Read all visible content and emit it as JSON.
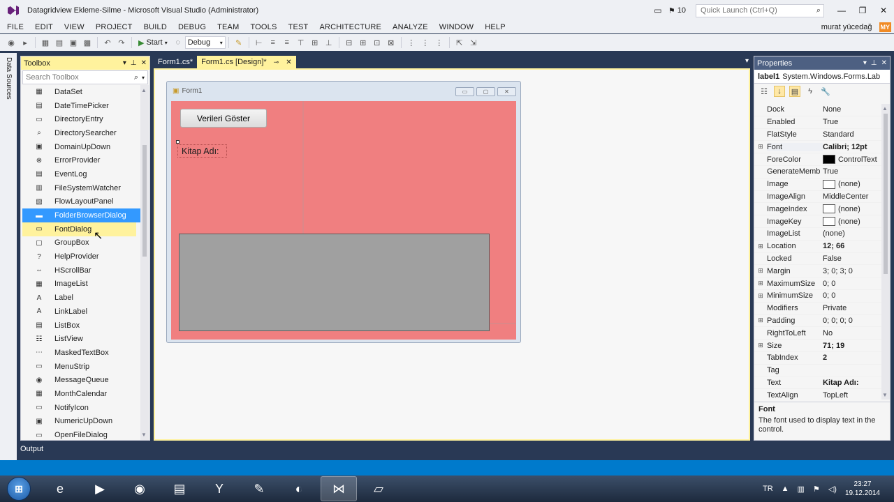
{
  "window": {
    "title": "Datagridview Ekleme-Silme - Microsoft Visual Studio (Administrator)",
    "notifications_count": "10",
    "quick_launch_placeholder": "Quick Launch (Ctrl+Q)"
  },
  "menu": {
    "items": [
      "FILE",
      "EDIT",
      "VIEW",
      "PROJECT",
      "BUILD",
      "DEBUG",
      "TEAM",
      "TOOLS",
      "TEST",
      "ARCHITECTURE",
      "ANALYZE",
      "WINDOW",
      "HELP"
    ],
    "user_name": "murat yücedağ",
    "user_initials": "MY"
  },
  "toolbar": {
    "start_label": "Start",
    "configuration": "Debug"
  },
  "side_strip": {
    "label": "Data Sources"
  },
  "toolbox": {
    "title": "Toolbox",
    "search_placeholder": "Search Toolbox",
    "items": [
      {
        "label": "DataSet",
        "icon": "dataset-icon",
        "glyph": "▦"
      },
      {
        "label": "DateTimePicker",
        "icon": "datetimepicker-icon",
        "glyph": "▤"
      },
      {
        "label": "DirectoryEntry",
        "icon": "directoryentry-icon",
        "glyph": "▭"
      },
      {
        "label": "DirectorySearcher",
        "icon": "directorysearcher-icon",
        "glyph": "⌕"
      },
      {
        "label": "DomainUpDown",
        "icon": "domainupdown-icon",
        "glyph": "▣"
      },
      {
        "label": "ErrorProvider",
        "icon": "errorprovider-icon",
        "glyph": "⊗"
      },
      {
        "label": "EventLog",
        "icon": "eventlog-icon",
        "glyph": "▤"
      },
      {
        "label": "FileSystemWatcher",
        "icon": "filesystemwatcher-icon",
        "glyph": "▥"
      },
      {
        "label": "FlowLayoutPanel",
        "icon": "flowlayoutpanel-icon",
        "glyph": "▧"
      },
      {
        "label": "FolderBrowserDialog",
        "icon": "folderbrowserdialog-icon",
        "glyph": "▬"
      },
      {
        "label": "FontDialog",
        "icon": "fontdialog-icon",
        "glyph": "▭"
      },
      {
        "label": "GroupBox",
        "icon": "groupbox-icon",
        "glyph": "▢"
      },
      {
        "label": "HelpProvider",
        "icon": "helpprovider-icon",
        "glyph": "?"
      },
      {
        "label": "HScrollBar",
        "icon": "hscrollbar-icon",
        "glyph": "⇔"
      },
      {
        "label": "ImageList",
        "icon": "imagelist-icon",
        "glyph": "▦"
      },
      {
        "label": "Label",
        "icon": "label-icon",
        "glyph": "A"
      },
      {
        "label": "LinkLabel",
        "icon": "linklabel-icon",
        "glyph": "A"
      },
      {
        "label": "ListBox",
        "icon": "listbox-icon",
        "glyph": "▤"
      },
      {
        "label": "ListView",
        "icon": "listview-icon",
        "glyph": "☷"
      },
      {
        "label": "MaskedTextBox",
        "icon": "maskedtextbox-icon",
        "glyph": "⋯"
      },
      {
        "label": "MenuStrip",
        "icon": "menustrip-icon",
        "glyph": "▭"
      },
      {
        "label": "MessageQueue",
        "icon": "messagequeue-icon",
        "glyph": "◉"
      },
      {
        "label": "MonthCalendar",
        "icon": "monthcalendar-icon",
        "glyph": "▦"
      },
      {
        "label": "NotifyIcon",
        "icon": "notifyicon-icon",
        "glyph": "▭"
      },
      {
        "label": "NumericUpDown",
        "icon": "numericupdown-icon",
        "glyph": "▣"
      },
      {
        "label": "OpenFileDialog",
        "icon": "openfiledialog-icon",
        "glyph": "▭"
      }
    ],
    "selected_index": 9,
    "hover_index": 10
  },
  "tabs": [
    {
      "label": "Form1.cs*",
      "active": false
    },
    {
      "label": "Form1.cs [Design]*",
      "active": true
    }
  ],
  "designer": {
    "form_title": "Form1",
    "form_backcolor": "#f07f80",
    "button_text": "Verileri Göster",
    "label_text": "Kitap Adı:"
  },
  "properties": {
    "title": "Properties",
    "object_name": "label1",
    "object_type": "System.Windows.Forms.Lab",
    "rows": [
      {
        "name": "Dock",
        "value": "None",
        "expandable": false,
        "bold": false
      },
      {
        "name": "Enabled",
        "value": "True",
        "expandable": false,
        "bold": false
      },
      {
        "name": "FlatStyle",
        "value": "Standard",
        "expandable": false,
        "bold": false
      },
      {
        "name": "Font",
        "value": "Calibri; 12pt",
        "expandable": true,
        "bold": true
      },
      {
        "name": "ForeColor",
        "value": "ControlText",
        "expandable": false,
        "bold": false,
        "swatch": "black"
      },
      {
        "name": "GenerateMemb",
        "value": "True",
        "expandable": false,
        "bold": false
      },
      {
        "name": "Image",
        "value": "(none)",
        "expandable": false,
        "bold": false,
        "swatch": "white"
      },
      {
        "name": "ImageAlign",
        "value": "MiddleCenter",
        "expandable": false,
        "bold": false
      },
      {
        "name": "ImageIndex",
        "value": "(none)",
        "expandable": false,
        "bold": false,
        "swatch": "white"
      },
      {
        "name": "ImageKey",
        "value": "(none)",
        "expandable": false,
        "bold": false,
        "swatch": "white"
      },
      {
        "name": "ImageList",
        "value": "(none)",
        "expandable": false,
        "bold": false
      },
      {
        "name": "Location",
        "value": "12; 66",
        "expandable": true,
        "bold": true
      },
      {
        "name": "Locked",
        "value": "False",
        "expandable": false,
        "bold": false
      },
      {
        "name": "Margin",
        "value": "3; 0; 3; 0",
        "expandable": true,
        "bold": false
      },
      {
        "name": "MaximumSize",
        "value": "0; 0",
        "expandable": true,
        "bold": false
      },
      {
        "name": "MinimumSize",
        "value": "0; 0",
        "expandable": true,
        "bold": false
      },
      {
        "name": "Modifiers",
        "value": "Private",
        "expandable": false,
        "bold": false
      },
      {
        "name": "Padding",
        "value": "0; 0; 0; 0",
        "expandable": true,
        "bold": false
      },
      {
        "name": "RightToLeft",
        "value": "No",
        "expandable": false,
        "bold": false
      },
      {
        "name": "Size",
        "value": "71; 19",
        "expandable": true,
        "bold": true
      },
      {
        "name": "TabIndex",
        "value": "2",
        "expandable": false,
        "bold": true
      },
      {
        "name": "Tag",
        "value": "",
        "expandable": false,
        "bold": false
      },
      {
        "name": "Text",
        "value": "Kitap Adı:",
        "expandable": false,
        "bold": true
      },
      {
        "name": "TextAlign",
        "value": "TopLeft",
        "expandable": false,
        "bold": false
      }
    ],
    "selected_row": 3,
    "description_title": "Font",
    "description_text": "The font used to display text in the control."
  },
  "output": {
    "label": "Output"
  },
  "taskbar": {
    "apps": [
      {
        "name": "internet-explorer",
        "glyph": "e"
      },
      {
        "name": "media-player",
        "glyph": "▶"
      },
      {
        "name": "chrome",
        "glyph": "◉"
      },
      {
        "name": "file-explorer",
        "glyph": "▤"
      },
      {
        "name": "yandex-browser",
        "glyph": "Y"
      },
      {
        "name": "tools-app",
        "glyph": "✎"
      },
      {
        "name": "obs",
        "glyph": "◐"
      },
      {
        "name": "visual-studio",
        "glyph": "⋈"
      },
      {
        "name": "notepad",
        "glyph": "▱"
      }
    ],
    "active_app": 7,
    "language": "TR",
    "time": "23:27",
    "date": "19.12.2014"
  },
  "colors": {
    "accent": "#007acc",
    "toolbox_header": "#fff29d",
    "properties_header": "#4d6082",
    "selection": "#3399ff"
  }
}
